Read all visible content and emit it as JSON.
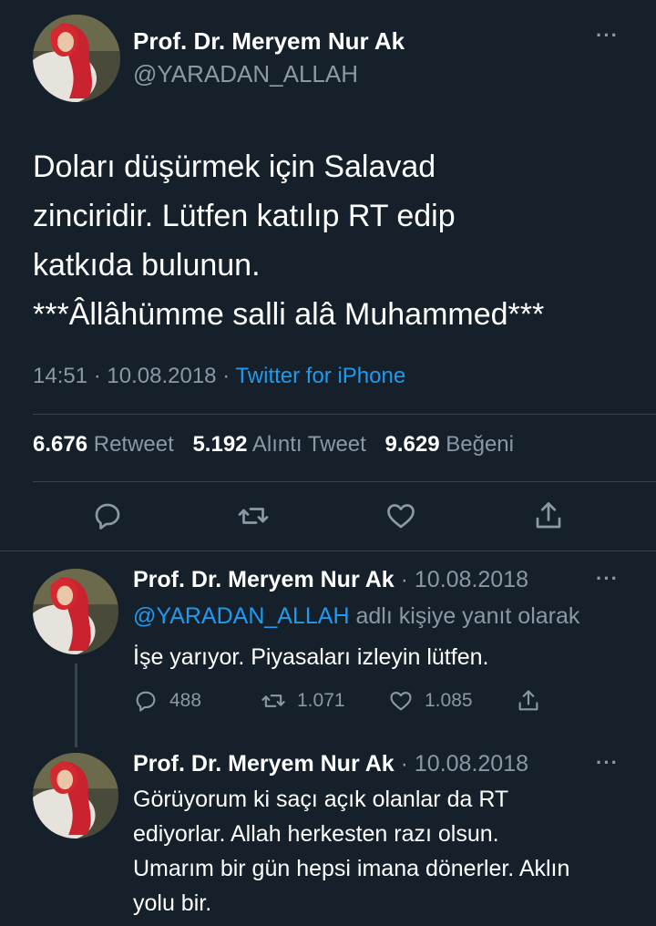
{
  "tweet": {
    "author_name": "Prof. Dr. Meryem Nur Ak",
    "handle": "@YARADAN_ALLAH",
    "text_lines": [
      "Doları düşürmek için Salavad",
      "zinciridir.  Lütfen katılıp RT edip",
      "katkıda bulunun.",
      "***Âllâhümme salli alâ Muhammed***"
    ],
    "time": "14:51",
    "sep": "·",
    "date": "10.08.2018",
    "source": "Twitter for iPhone",
    "stats": {
      "retweets": "6.676",
      "retweets_label": "Retweet",
      "quotes": "5.192",
      "quotes_label": "Alıntı Tweet",
      "likes": "9.629",
      "likes_label": "Beğeni"
    }
  },
  "replies": [
    {
      "author_name": "Prof. Dr. Meryem Nur Ak",
      "date": "· 10.08.2018",
      "reply_to_handle": "@YARADAN_ALLAH",
      "reply_to_suffix": "adlı kişiye yanıt olarak",
      "text_lines": [
        "İşe yarıyor. Piyasaları izleyin lütfen."
      ],
      "reply_count": "488",
      "retweet_count": "1.071",
      "like_count": "1.085"
    },
    {
      "author_name": "Prof. Dr. Meryem Nur Ak",
      "date": "· 10.08.2018",
      "text_lines": [
        "Görüyorum ki saçı açık olanlar da RT",
        "ediyorlar. Allah herkesten razı olsun.",
        "Umarım bir gün hepsi imana dönerler. Aklın",
        "yolu bir."
      ]
    }
  ],
  "icons": {
    "more": "more-icon",
    "reply": "reply-icon",
    "retweet": "retweet-icon",
    "like": "like-icon",
    "share": "share-icon"
  },
  "colors": {
    "background": "#15202b",
    "text": "#ffffff",
    "muted": "#8b98a5",
    "link": "#1d9bf0",
    "divider": "#38444d"
  }
}
